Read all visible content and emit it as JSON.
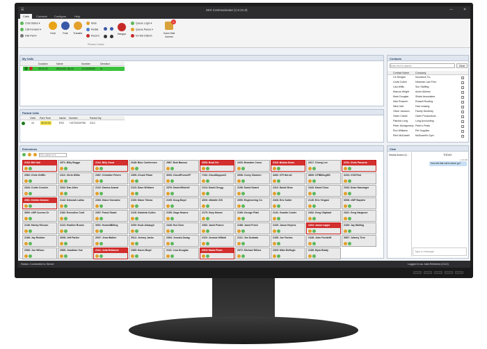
{
  "window": {
    "title": "3SX Communicator (1.0.21.0)"
  },
  "ribbon": {
    "tabs": [
      "Calls",
      "Contacts",
      "Configure",
      "Help"
    ],
    "chat_status": "Chat Status",
    "call_forward": "Call Forward",
    "dial_pad": "Dial Pad",
    "hold": "Hold",
    "park": "Park",
    "transfer": "Transfer",
    "mute": "Mute",
    "redial": "Redial",
    "record": "Record",
    "hangup": "Hangup",
    "queue_login": "Queue Login",
    "queue_pause": "Queue Pause",
    "do_not_disturb": "Do Not Disturb",
    "voicemail": "Voice Mail",
    "voicemail_sub": "Access",
    "group_label": "Phones Control",
    "vm_badge": "2"
  },
  "my_calls": {
    "title": "My Calls",
    "columns": [
      "Duration",
      "Name",
      "Number",
      "Direction"
    ],
    "row": {
      "duration": "00:01:01",
      "name": "8004440 JULIA",
      "number": "1214430050",
      "direction": "In"
    }
  },
  "parked_calls": {
    "title": "Parked Calls",
    "columns": [
      "Orbit",
      "Park Time",
      "Name",
      "Number",
      "Parked By"
    ],
    "row": {
      "orbit": "10",
      "park_time": "00:01:01",
      "name": "ESC",
      "number": "+19724229750",
      "parked_by": "2112"
    }
  },
  "extensions": {
    "title": "Extensions",
    "search_placeholder": "Ext, name or #",
    "cards": [
      {
        "label": "2103: Bill Hall",
        "state": "red"
      },
      {
        "label": "2071: Billy Boggs",
        "state": "normal"
      },
      {
        "label": "2114: Billy Good",
        "state": "red"
      },
      {
        "label": "2048: Blue Conference",
        "state": "normal"
      },
      {
        "label": "2567: Bob Bassos",
        "state": "normal"
      },
      {
        "label": "2095: Brad Orr",
        "state": "red"
      },
      {
        "label": "2420: Brandon Cross",
        "state": "normal"
      },
      {
        "label": "2118: Bubba Dixon",
        "state": "red"
      },
      {
        "label": "2017: Cheng Lee",
        "state": "normal"
      },
      {
        "label": "2101: Chris Parsons",
        "state": "red"
      },
      {
        "label": "2062: Chris Griffin",
        "state": "normal"
      },
      {
        "label": "2112: Chris Willis",
        "state": "normal"
      },
      {
        "label": "2367: Christine Peters",
        "state": "normal"
      },
      {
        "label": "2265: Chuck Pham",
        "state": "normal"
      },
      {
        "label": "3003: CloudPromoVF",
        "state": "normal"
      },
      {
        "label": "7102: CloudSupport1",
        "state": "normal"
      },
      {
        "label": "2936: Corey Zimmerr",
        "state": "normal"
      },
      {
        "label": "4262: CPI Hot all",
        "state": "normal"
      },
      {
        "label": "3805: CPIBillingMS",
        "state": "normal"
      },
      {
        "label": "3103: CSCPilot",
        "state": "normal"
      },
      {
        "label": "2344: Curtis Crocker",
        "state": "normal"
      },
      {
        "label": "2332: Dan Allen",
        "state": "normal"
      },
      {
        "label": "2122: Danica Avanzi",
        "state": "normal"
      },
      {
        "label": "2123: Dave Whitmer",
        "state": "normal"
      },
      {
        "label": "2376: David Mitchell",
        "state": "normal"
      },
      {
        "label": "2124: David Gregg",
        "state": "normal"
      },
      {
        "label": "2196: David Sward",
        "state": "normal"
      },
      {
        "label": "2113: David Wroe",
        "state": "normal"
      },
      {
        "label": "2443: David Choo",
        "state": "normal"
      },
      {
        "label": "2343: Dean Hassinger",
        "state": "normal"
      },
      {
        "label": "2061: Debbie Alvarez",
        "state": "red"
      },
      {
        "label": "2142: Deborah Lallas",
        "state": "normal"
      },
      {
        "label": "2263: Diane Gonzalez",
        "state": "normal"
      },
      {
        "label": "2150: Diane Tebow",
        "state": "normal"
      },
      {
        "label": "2105: Doug Boyd",
        "state": "normal"
      },
      {
        "label": "4000: eMobile iOS",
        "state": "normal"
      },
      {
        "label": "2050: Engineering Co",
        "state": "normal"
      },
      {
        "label": "2326: Eric Suiter",
        "state": "normal"
      },
      {
        "label": "2145: Eric Yergasi",
        "state": "normal"
      },
      {
        "label": "3006: eSIP Bayden",
        "state": "normal"
      },
      {
        "label": "3500: eSIP Access Sr",
        "state": "normal"
      },
      {
        "label": "2182: Executive Conf",
        "state": "normal"
      },
      {
        "label": "2267: Frank Stuart",
        "state": "normal"
      },
      {
        "label": "2126: Gabriela Cullen",
        "state": "normal"
      },
      {
        "label": "2155: Gage Hearne",
        "state": "normal"
      },
      {
        "label": "2175: Gary Homer",
        "state": "normal"
      },
      {
        "label": "2169: George Platt",
        "state": "normal"
      },
      {
        "label": "2141: Granite Cooler",
        "state": "normal"
      },
      {
        "label": "2402: Greg Oliphant",
        "state": "normal"
      },
      {
        "label": "2321: Greg Hargrove",
        "state": "normal"
      },
      {
        "label": "2146: Harley Ericson",
        "state": "normal"
      },
      {
        "label": "2122: Heather Brown",
        "state": "normal"
      },
      {
        "label": "3001: HostedBilling",
        "state": "normal"
      },
      {
        "label": "2200: Huck Arbaugh",
        "state": "normal"
      },
      {
        "label": "2449: Hui Chen",
        "state": "normal"
      },
      {
        "label": "2352: Janet Pearce",
        "state": "normal"
      },
      {
        "label": "2186: Jared Fresh",
        "state": "normal"
      },
      {
        "label": "2100: Jason Heyens",
        "state": "normal"
      },
      {
        "label": "2434: Jason Lappe",
        "state": "red"
      },
      {
        "label": "2169: Jay Walling",
        "state": "normal"
      },
      {
        "label": "2166: Jay Redden",
        "state": "normal"
      },
      {
        "label": "3008: Jeff Parker",
        "state": "normal"
      },
      {
        "label": "2037: Jena Walker",
        "state": "normal"
      },
      {
        "label": "2012: Jeremy Jacks",
        "state": "normal"
      },
      {
        "label": "2394: Jessica Zavag",
        "state": "normal"
      },
      {
        "label": "2119: Jessica Hilfdoll",
        "state": "normal"
      },
      {
        "label": "2112: Jim Scobala",
        "state": "normal"
      },
      {
        "label": "2165: Joe Forbes",
        "state": "normal"
      },
      {
        "label": "2448: John Forsteiff",
        "state": "normal"
      },
      {
        "label": "3067: Johnny Trea",
        "state": "normal"
      },
      {
        "label": "2306: Jon Wilson",
        "state": "normal"
      },
      {
        "label": "2565: Jonathan Vue",
        "state": "normal"
      },
      {
        "label": "2112: Julia Rebbeed",
        "state": "red"
      },
      {
        "label": "2389: Karen Boyd",
        "state": "normal"
      },
      {
        "label": "2121: Lisa Douglas",
        "state": "normal"
      },
      {
        "label": "2019: Maria Pham",
        "state": "red"
      },
      {
        "label": "2072: Michael Dillow",
        "state": "normal"
      },
      {
        "label": "2329: Mike McHugh",
        "state": "normal"
      },
      {
        "label": "2168: Myra Brady",
        "state": "normal"
      }
    ]
  },
  "contacts": {
    "title": "Contacts",
    "search_placeholder": "Enter text to search...",
    "clear": "Clear",
    "columns": [
      "Contact Name",
      "Company"
    ],
    "rows": [
      [
        "Lin Morgan",
        "Insurance Co."
      ],
      [
        "Linda Culkin",
        "Newman Law Firm"
      ],
      [
        "Lisa Willis",
        "Sun Staffing"
      ],
      [
        "Marcus Wright",
        "Acme Airlines"
      ],
      [
        "Mark Douglas",
        "Shlain Associates"
      ],
      [
        "Nick Rowsell",
        "Russell Roofing"
      ],
      [
        "Nina Hart",
        "Hart Leasing"
      ],
      [
        "Oliver Jackson",
        "Family Dentistry"
      ],
      [
        "Owen Clarke",
        "Owen Productions"
      ],
      [
        "Patricia Long",
        "Long Accounting"
      ],
      [
        "Peter Montgomery",
        "Peter's Pests"
      ],
      [
        "Ron Williams",
        "Pet Supplies"
      ],
      [
        "Rich McDowell",
        "McDowell's Gym"
      ]
    ]
  },
  "chat": {
    "title": "Chat",
    "contact": "Dwivia Avanzi (2...",
    "day": "TODAY",
    "time": "1:15 PM",
    "message": "How did that call to Acme go?",
    "input_placeholder": "Type a message"
  },
  "status": {
    "left": "Status: Connected to Server",
    "right": "Logged in as Julia Rebbeed (2112)"
  }
}
